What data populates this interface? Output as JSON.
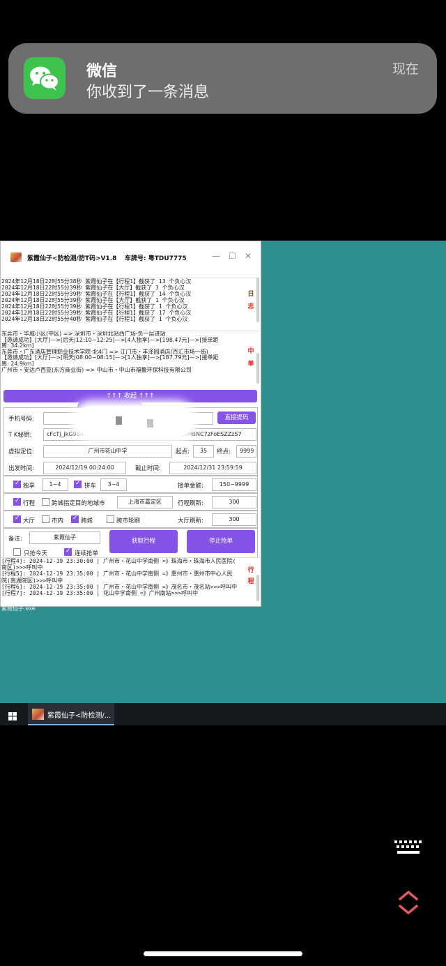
{
  "notification": {
    "app_name": "微信",
    "message": "你收到了一条消息",
    "time": "现在"
  },
  "window": {
    "title": "紫霞仙子<防检测/防T码>V1.8",
    "plate": "车牌号: 粤TDU7775",
    "log_lines": [
      "2024年12月18日22时55分38秒 紫霞仙子在【行程1】截获了  13  个负心汉",
      "2024年12月18日22时55分39秒 紫霞仙子在【大厅】截获了  3  个负心汉",
      "2024年12月18日22时55分39秒 紫霞仙子在【行程1】截获了  14  个负心汉",
      "2024年12月18日22时55分39秒 紫霞仙子在【大厅】截获了  1  个负心汉",
      "2024年12月18日22时55分39秒 紫霞仙子在【行程1】截获了  1  个负心汉",
      "2024年12月18日22时55分39秒 紫霞仙子在【行程1】截获了  17  个负心汉",
      "2024年12月18日22时55分40秒 紫霞仙子在【行程1】截获了  1  个负心汉"
    ],
    "log_side": [
      "日",
      "志"
    ],
    "order_lines": [
      "东莞市・华威小区(中区) => 深圳市・深圳北站西广场-负一层进站",
      "【邀请成功】[大厅]—>[后天|12:10~12:25]—>[4人独享]—>[198.47元]—>[接单距",
      "离: 34.2km]",
      "东莞市・广东酒店管理职业技术学院-北4门 => 江门市・丰泽园酒店(百汇市场一街)",
      "【邀请成功】[大厅]—>[明天|08:00~08:15]—>[1人独享]—>[187.79元]—>[接单距",
      "离: 24.9km]",
      "广州市・安达卢西亚(东方商业街) => 中山市・中山市福鳌环保科技有限公司"
    ],
    "order_side": [
      "中",
      "单"
    ],
    "fold_label": "↑↑↑    收起    ↑↑↑",
    "form": {
      "phone_label": "手机号码:",
      "phone_value": "",
      "extract_btn": "直接提码",
      "tk_label": "T K秘钥:",
      "tk_value_left": "cFcTj_jkG98nln.L",
      "tk_value_right": ".ruSyfAkzEsKwzAMBNC7zFoESZZzS7",
      "location_label": "虚拟定位:",
      "location_value": "广州市花山中学",
      "start_label": "起点:",
      "start_value": "35",
      "end_label": "终点:",
      "end_value": "9999",
      "depart_label": "出发时间:",
      "depart_value": "2024/12/19 00:24:00",
      "deadline_label": "截止时间:",
      "deadline_value": "2024/12/31 23:59:59",
      "exclusive_label": "独享",
      "exclusive_range": "1~4",
      "carpool_label": "拼车",
      "carpool_range": "3~4",
      "amount_label": "接单金额:",
      "amount_value": "150~9999",
      "trip_label": "行程",
      "cross_city_dest_label": "跨城指定目的地城市",
      "cross_city_dest_value": "上海市嘉定区",
      "trip_refresh_label": "行程刷新:",
      "trip_refresh_value": "300",
      "hall_label": "大厅",
      "intracity_label": "市内",
      "crosscity_label": "跨城",
      "crosscity_rotate_label": "跨市轮刷",
      "hall_refresh_label": "大厅刷新:",
      "hall_refresh_value": "300",
      "note_label": "备注:",
      "note_value": "紫霞仙子",
      "get_trip_btn": "获取行程",
      "stop_btn": "停止抢单",
      "today_only_label": "只抢今天",
      "continuous_label": "连续抢单"
    },
    "trip_lines": [
      "[行程4]: 2024-12-19 23:30:00 | 广州市・花山中学南侧 =》珠海市・珠海市人民医院(",
      "南区)>>>呼叫中",
      "[行程5]: 2024-12-19 23:35:00 | 广州市・花山中学南侧 =》惠州市・惠州市中心人民",
      "院(南湖院区)>>>呼叫中",
      "[行程6]: 2024-12-19 23:35:00 | 广州市・花山中学南侧 =》茂名市・茂名站>>>呼叫中",
      "[行程7]: 2024-12-19 23:35:00 | 花山中学南侧 =》广州南站>>>呼叫中"
    ],
    "trip_side": [
      "行",
      "程"
    ]
  },
  "desktop": {
    "exe_label": "紫霞仙子.exe"
  },
  "taskbar": {
    "item_label": "紫霞仙子<防检测/..."
  },
  "colors": {
    "accent": "#8553e8",
    "desktop_bg": "#2e8f8e",
    "wechat_green": "#3fc34f",
    "log_side_red": "#d9261c",
    "nav_icon_red": "#e0595d"
  },
  "icons": [
    "wechat-icon",
    "app-logo-icon",
    "minimize-icon",
    "maximize-icon",
    "close-icon",
    "windows-start-icon",
    "keyboard-icon",
    "up-down-nav-icon"
  ]
}
